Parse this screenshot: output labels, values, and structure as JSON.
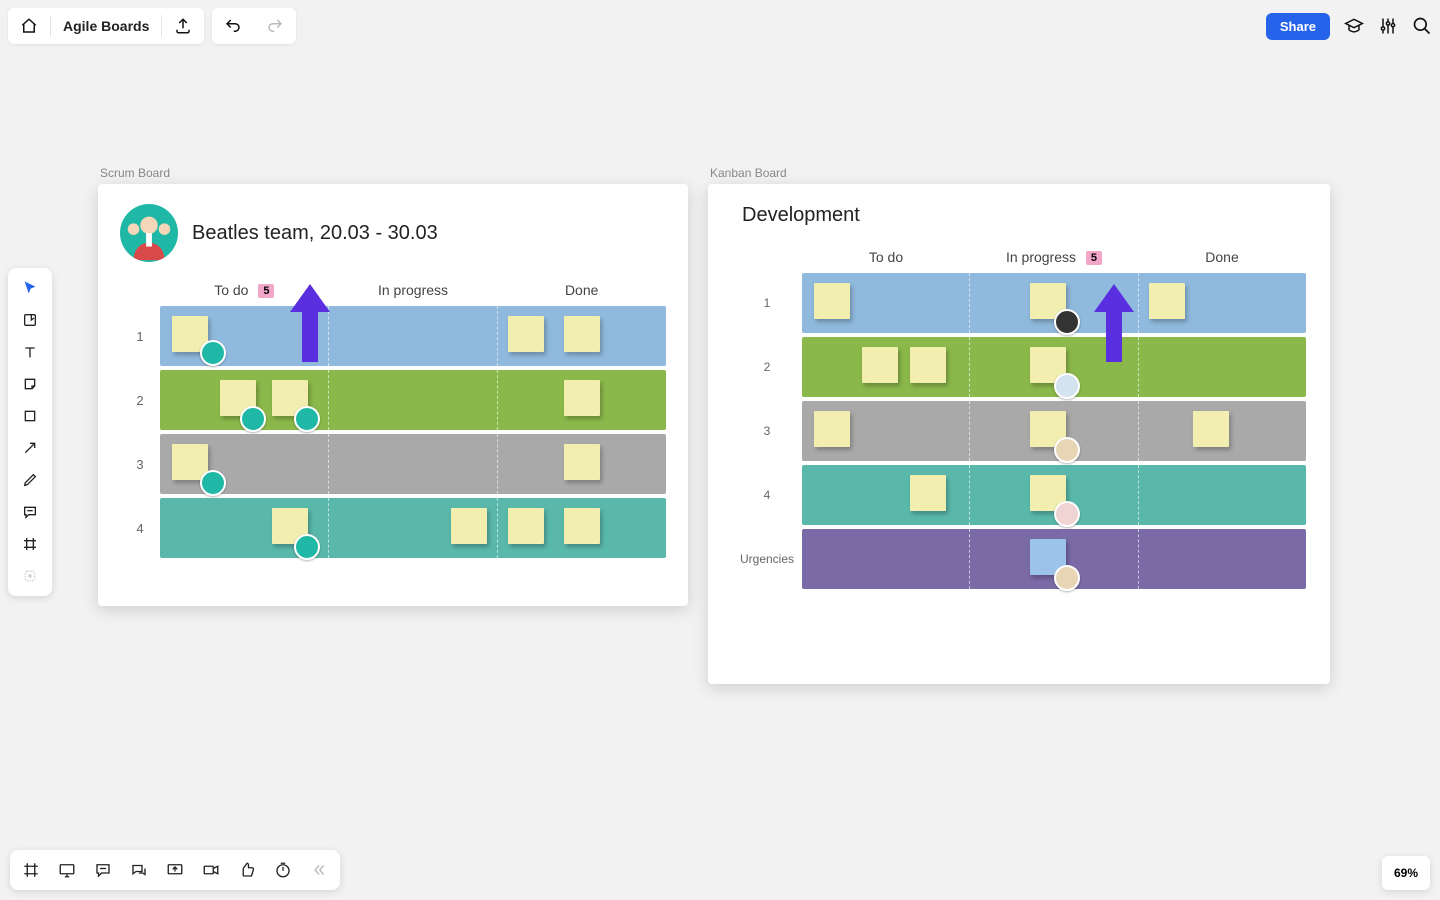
{
  "header": {
    "home_label": "Home",
    "title": "Agile Boards",
    "share_label": "Share"
  },
  "zoom": "69%",
  "scrum": {
    "frame_label": "Scrum Board",
    "title": "Beatles team, 20.03 - 30.03",
    "columns": [
      "To do",
      "In progress",
      "Done"
    ],
    "wip_badge": "5",
    "row_labels": [
      "1",
      "2",
      "3",
      "4"
    ]
  },
  "kanban": {
    "frame_label": "Kanban Board",
    "title": "Development",
    "columns": [
      "To do",
      "In progress",
      "Done"
    ],
    "wip_badge": "5",
    "row_labels": [
      "1",
      "2",
      "3",
      "4",
      "Urgencies"
    ]
  }
}
